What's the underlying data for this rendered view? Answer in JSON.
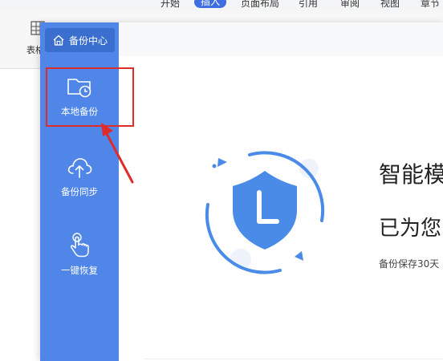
{
  "ribbon": {
    "tabs": [
      {
        "label": "开始"
      },
      {
        "label": "插入"
      },
      {
        "label": "页面布局"
      },
      {
        "label": "引用"
      },
      {
        "label": "审阅"
      },
      {
        "label": "视图"
      },
      {
        "label": "章节"
      }
    ],
    "table_label": "表格"
  },
  "sidebar": {
    "header": "备份中心",
    "items": [
      {
        "label": "本地备份",
        "icon": "folder-clock-icon",
        "selected": true
      },
      {
        "label": "备份同步",
        "icon": "cloud-upload-icon"
      },
      {
        "label": "一键恢复",
        "icon": "hand-tap-icon"
      }
    ]
  },
  "main": {
    "title": "智能模",
    "subtitle": "已为您",
    "note": "备份保存30天"
  },
  "colors": {
    "sidebar": "#4f86e8",
    "sidebar_header": "#3a6fd0",
    "shield": "#4a8be8",
    "highlight": "#e02b2b"
  }
}
